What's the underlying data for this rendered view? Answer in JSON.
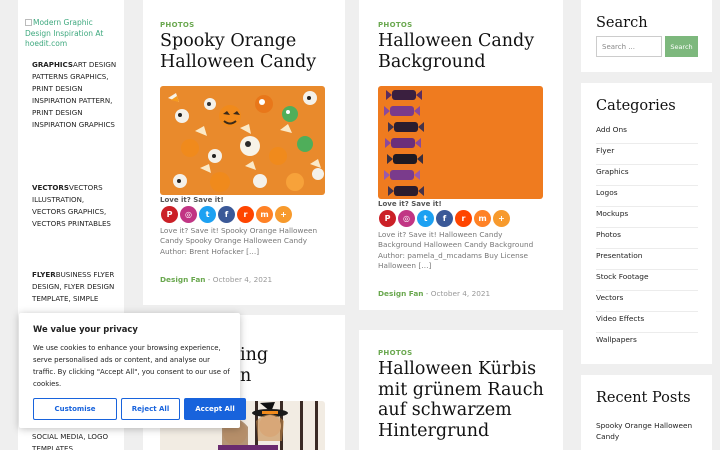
{
  "site": {
    "logo_alt": "Modern Graphic Design Inspiration At hoedit.com"
  },
  "left_nav": [
    {
      "head": "GRAPHICS",
      "rest": "ART DESIGN PATTERNS GRAPHICS, PRINT DESIGN INSPIRATION PATTERN, PRINT DESIGN INSPIRATION GRAPHICS"
    },
    {
      "head": "VECTORS",
      "rest": "VECTORS ILLUSTRATION, VECTORS GRAPHICS, VECTORS PRINTABLES"
    },
    {
      "head": "FLYER",
      "rest": "BUSINESS FLYER DESIGN, FLYER DESIGN TEMPLATE, SIMPLE"
    }
  ],
  "left_nav_bottom": "SOCIAL MEDIA, LOGO TEMPLATES",
  "posts": [
    {
      "category": "PHOTOS",
      "title": "Spooky Orange Halloween Candy",
      "love": "Love it? Save it!",
      "excerpt": "Love it? Save it! Spooky Orange Halloween Candy Spooky Orange Halloween Candy Author: Brent Hofacker […]",
      "author": "Design Fan",
      "date": "October 4, 2021"
    },
    {
      "category": "PHOTOS",
      "title": "Halloween Candy Background",
      "love": "Love it? Save it!",
      "excerpt": "Love it? Save it! Halloween Candy Background Halloween Candy Background Author: pamela_d_mcadams Buy License Halloween […]",
      "author": "Design Fan",
      "date": "October 4, 2021"
    },
    {
      "title_fragment_1": "ing",
      "title_fragment_2": "n"
    },
    {
      "category": "PHOTOS",
      "title": "Halloween Kürbis mit grünem Rauch auf schwarzem Hintergrund"
    }
  ],
  "share_icons": [
    {
      "name": "pinterest-icon",
      "glyph": "P",
      "color": "#cb2027"
    },
    {
      "name": "instagram-icon",
      "glyph": "◎",
      "color": "#c13584"
    },
    {
      "name": "twitter-icon",
      "glyph": "t",
      "color": "#1da1f2"
    },
    {
      "name": "facebook-icon",
      "glyph": "f",
      "color": "#3b5998"
    },
    {
      "name": "reddit-icon",
      "glyph": "r",
      "color": "#ff4500"
    },
    {
      "name": "mix-icon",
      "glyph": "m",
      "color": "#ff8226"
    },
    {
      "name": "more-icon",
      "glyph": "+",
      "color": "#f79a2d"
    }
  ],
  "search": {
    "title": "Search",
    "placeholder": "Search ...",
    "button": "Search"
  },
  "categories": {
    "title": "Categories",
    "items": [
      "Add Ons",
      "Flyer",
      "Graphics",
      "Logos",
      "Mockups",
      "Photos",
      "Presentation",
      "Stock Footage",
      "Vectors",
      "Video Effects",
      "Wallpapers"
    ]
  },
  "recent": {
    "title": "Recent Posts",
    "first": "Spooky Orange Halloween Candy"
  },
  "cookie": {
    "title": "We value your privacy",
    "text": "We use cookies to enhance your browsing experience, serve personalised ads or content, and analyse our traffic. By clicking \"Accept All\", you consent to our use of cookies.",
    "customise": "Customise",
    "reject": "Reject All",
    "accept": "Accept All"
  },
  "colors": {
    "accent_green": "#6aa84f",
    "cookie_blue": "#1863dc",
    "candy_orange": "#ef7b1f"
  }
}
